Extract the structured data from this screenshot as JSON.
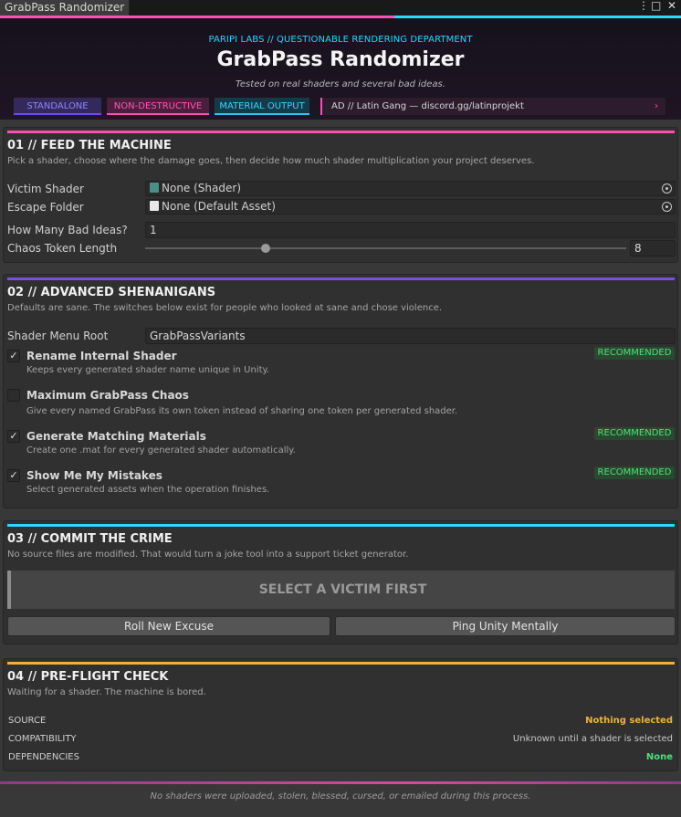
{
  "window": {
    "tab_title": "GrabPass Randomizer",
    "menu_glyph": "⋮",
    "maximize_glyph": "□",
    "close_glyph": "✕"
  },
  "header": {
    "eyebrow": "PARIPI LABS // QUESTIONABLE RENDERING DEPARTMENT",
    "title": "GrabPass Randomizer",
    "subtitle": "Tested on real shaders and several bad ideas.",
    "pills": {
      "standalone": "STANDALONE",
      "non_destructive": "NON-DESTRUCTIVE",
      "material_output": "MATERIAL OUTPUT"
    },
    "ad": {
      "text": "AD // Latin Gang — discord.gg/latinprojekt",
      "arrow": "›"
    }
  },
  "section1": {
    "title": "01 // FEED THE MACHINE",
    "description": "Pick a shader, choose where the damage goes, then decide how much shader multiplication your project deserves.",
    "victim_label": "Victim Shader",
    "victim_value": "None (Shader)",
    "escape_label": "Escape Folder",
    "escape_value": "None (Default Asset)",
    "bad_ideas_label": "How Many Bad Ideas?",
    "bad_ideas_value": "1",
    "chaos_label": "Chaos Token Length",
    "chaos_value": "8",
    "chaos_fraction": 0.25
  },
  "section2": {
    "title": "02 // ADVANCED SHENANIGANS",
    "description": "Defaults are sane. The switches below exist for people who looked at sane and chose violence.",
    "menu_root_label": "Shader Menu Root",
    "menu_root_value": "GrabPassVariants",
    "check_glyph": "✓",
    "options": [
      {
        "title": "Rename Internal Shader",
        "desc": "Keeps every generated shader name unique in Unity.",
        "checked": true,
        "badge": "RECOMMENDED"
      },
      {
        "title": "Maximum GrabPass Chaos",
        "desc": "Give every named GrabPass its own token instead of sharing one token per generated shader.",
        "checked": false,
        "badge": ""
      },
      {
        "title": "Generate Matching Materials",
        "desc": "Create one .mat for every generated shader automatically.",
        "checked": true,
        "badge": "RECOMMENDED"
      },
      {
        "title": "Show Me My Mistakes",
        "desc": "Select generated assets when the operation finishes.",
        "checked": true,
        "badge": "RECOMMENDED"
      }
    ]
  },
  "section3": {
    "title": "03 // COMMIT THE CRIME",
    "description": "No source files are modified. That would turn a joke tool into a support ticket generator.",
    "main_button": "SELECT A VICTIM FIRST",
    "roll_button": "Roll New Excuse",
    "ping_button": "Ping Unity Mentally"
  },
  "section4": {
    "title": "04 // PRE-FLIGHT CHECK",
    "description": "Waiting for a shader. The machine is bored.",
    "rows": [
      {
        "label": "SOURCE",
        "value": "Nothing selected",
        "color": "#f0b03c"
      },
      {
        "label": "COMPATIBILITY",
        "value": "Unknown until a shader is selected",
        "color": "#c8c8c8"
      },
      {
        "label": "DEPENDENCIES",
        "value": "None",
        "color": "#4fe07a"
      }
    ]
  },
  "footer": {
    "text": "No shaders were uploaded, stolen, blessed, cursed, or emailed during this process."
  },
  "colors": {
    "pink": "#ff4fb0",
    "purple": "#7d4ce0",
    "cyan": "#2fd6ff",
    "amber": "#f0b03c",
    "green": "#4fe07a"
  }
}
